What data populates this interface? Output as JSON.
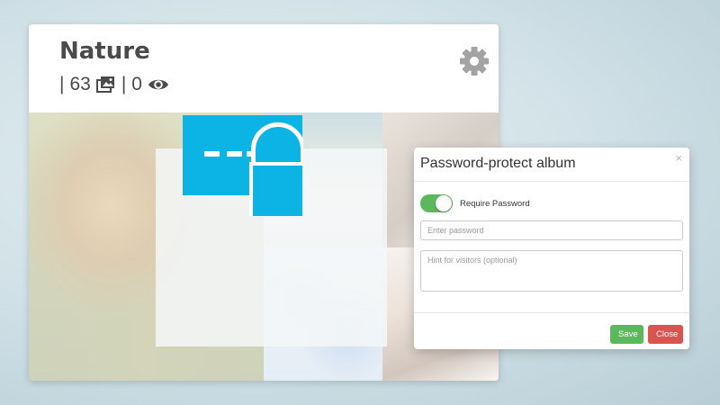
{
  "album": {
    "title": "Nature",
    "separator": "|",
    "photo_count": "63",
    "view_count": "0",
    "icons": {
      "photos": "photo-gallery-icon",
      "views": "eye-icon",
      "settings": "gear-icon",
      "lock": "password-lock-icon"
    }
  },
  "modal": {
    "title": "Password-protect album",
    "close_glyph": "×",
    "toggle": {
      "label": "Require Password",
      "on": true
    },
    "password": {
      "placeholder": "Enter password",
      "value": ""
    },
    "hint": {
      "placeholder": "Hint for visitors (optional)",
      "value": ""
    },
    "buttons": {
      "save": "Save",
      "close": "Close"
    }
  },
  "colors": {
    "accent_blue": "#0bb4e4",
    "save_green": "#5cb85c",
    "close_red": "#d9534f",
    "title_text": "#4a4a4a"
  }
}
